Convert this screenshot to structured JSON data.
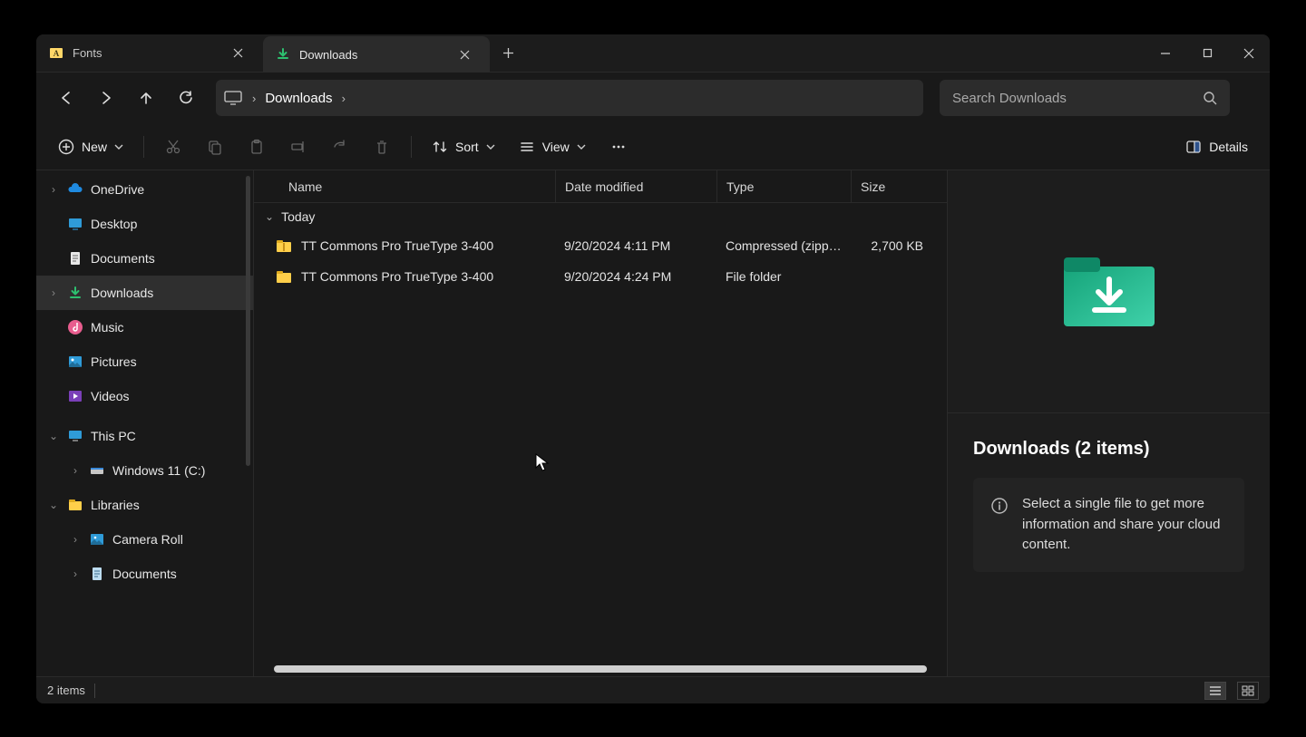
{
  "tabs": [
    {
      "title": "Fonts",
      "icon": "fonts"
    },
    {
      "title": "Downloads",
      "icon": "downloads"
    }
  ],
  "active_tab": 1,
  "address": {
    "crumb": "Downloads"
  },
  "search": {
    "placeholder": "Search Downloads"
  },
  "toolbar": {
    "new": "New",
    "sort": "Sort",
    "view": "View",
    "details": "Details"
  },
  "sidebar": {
    "items": [
      {
        "label": "OneDrive",
        "icon": "onedrive",
        "expandable": true
      },
      {
        "label": "Desktop",
        "icon": "desktop",
        "expandable": false
      },
      {
        "label": "Documents",
        "icon": "documents",
        "expandable": false
      },
      {
        "label": "Downloads",
        "icon": "downloads",
        "selected": true,
        "expandable": true
      },
      {
        "label": "Music",
        "icon": "music",
        "expandable": false
      },
      {
        "label": "Pictures",
        "icon": "pictures",
        "expandable": false
      },
      {
        "label": "Videos",
        "icon": "videos",
        "expandable": false
      },
      {
        "label": "This PC",
        "icon": "thispc",
        "expandable": true,
        "expanded": true
      },
      {
        "label": "Windows 11 (C:)",
        "icon": "drive",
        "indent": 1,
        "expandable": true
      },
      {
        "label": "Libraries",
        "icon": "libraries",
        "expandable": true,
        "expanded": true
      },
      {
        "label": "Camera Roll",
        "icon": "cameraroll",
        "indent": 1,
        "expandable": true
      },
      {
        "label": "Documents",
        "icon": "lib-doc",
        "indent": 1,
        "expandable": true
      }
    ]
  },
  "columns": {
    "name": "Name",
    "date": "Date modified",
    "type": "Type",
    "size": "Size"
  },
  "group": "Today",
  "files": [
    {
      "name": "TT Commons Pro TrueType 3-400",
      "date": "9/20/2024 4:11 PM",
      "type": "Compressed (zipp…",
      "size": "2,700 KB",
      "icon": "zip"
    },
    {
      "name": "TT Commons Pro TrueType 3-400",
      "date": "9/20/2024 4:24 PM",
      "type": "File folder",
      "size": "",
      "icon": "folder"
    }
  ],
  "preview": {
    "title": "Downloads (2 items)",
    "hint": "Select a single file to get more information and share your cloud content."
  },
  "status": {
    "count": "2 items"
  }
}
